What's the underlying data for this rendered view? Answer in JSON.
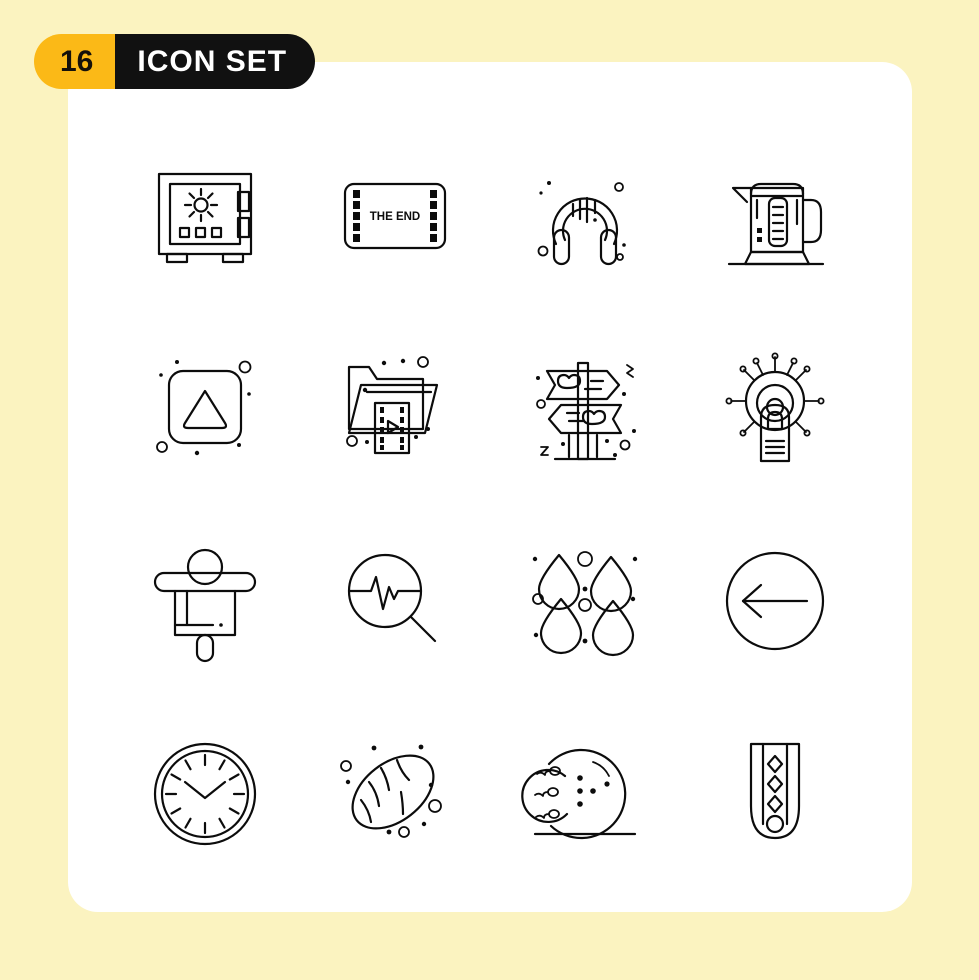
{
  "badge": {
    "count": "16",
    "title": "ICON SET",
    "count_bg": "#FBB917",
    "title_bg": "#111111",
    "title_color": "#FFFFFF"
  },
  "page": {
    "background_color": "#FBF3C0",
    "card_color": "#FFFFFF",
    "stroke_color": "#0C0C0C"
  },
  "grid": {
    "columns": 4,
    "rows": 4
  },
  "icons": [
    {
      "index": 1,
      "name": "safe-vault-icon",
      "label": "Safe"
    },
    {
      "index": 2,
      "name": "the-end-film-icon",
      "label": "The End",
      "text": "THE END"
    },
    {
      "index": 3,
      "name": "headphones-icon",
      "label": "Headphones"
    },
    {
      "index": 4,
      "name": "electric-kettle-icon",
      "label": "Kettle"
    },
    {
      "index": 5,
      "name": "play-triangle-button-icon",
      "label": "Play Button"
    },
    {
      "index": 6,
      "name": "video-folder-icon",
      "label": "Video Folder"
    },
    {
      "index": 7,
      "name": "direction-signpost-icon",
      "label": "Signpost"
    },
    {
      "index": 8,
      "name": "idea-bulb-tech-icon",
      "label": "Idea Bulb"
    },
    {
      "index": 9,
      "name": "scarecrow-icon",
      "label": "Scarecrow"
    },
    {
      "index": 10,
      "name": "pulse-search-icon",
      "label": "Pulse Search"
    },
    {
      "index": 11,
      "name": "water-drops-icon",
      "label": "Water Drops"
    },
    {
      "index": 12,
      "name": "back-arrow-circle-icon",
      "label": "Back Arrow"
    },
    {
      "index": 13,
      "name": "wall-clock-icon",
      "label": "Clock"
    },
    {
      "index": 14,
      "name": "bread-loaf-icon",
      "label": "Bread"
    },
    {
      "index": 15,
      "name": "bowling-ball-icon",
      "label": "Bowling Ball"
    },
    {
      "index": 16,
      "name": "necktie-icon",
      "label": "Necktie"
    }
  ]
}
